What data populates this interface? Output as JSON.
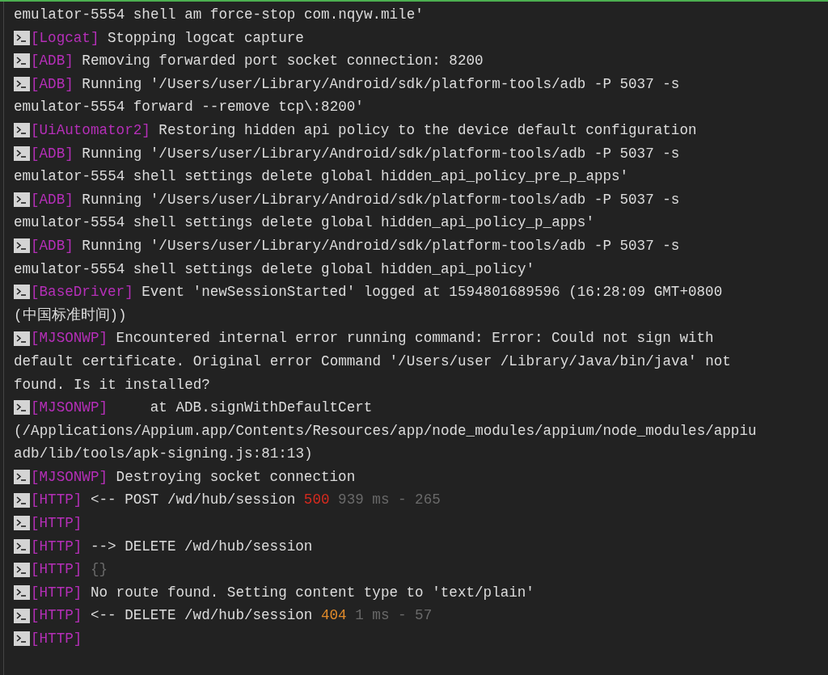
{
  "log": [
    {
      "kind": "wrap",
      "text": "emulator-5554 shell am force-stop com.nqyw.mile'"
    },
    {
      "kind": "entry",
      "tag": "[Logcat]",
      "segments": [
        {
          "kind": "text",
          "text": "Stopping logcat capture"
        }
      ]
    },
    {
      "kind": "entry",
      "tag": "[ADB]",
      "segments": [
        {
          "kind": "text",
          "text": "Removing forwarded port socket connection: 8200"
        }
      ]
    },
    {
      "kind": "entry",
      "tag": "[ADB]",
      "segments": [
        {
          "kind": "text",
          "text": "Running '/Users/user/Library/Android/sdk/platform-tools/adb -P 5037 -s"
        }
      ]
    },
    {
      "kind": "wrap",
      "text": "emulator-5554 forward --remove tcp\\:8200'"
    },
    {
      "kind": "entry",
      "tag": "[UiAutomator2]",
      "segments": [
        {
          "kind": "text",
          "text": "Restoring hidden api policy to the device default configuration"
        }
      ]
    },
    {
      "kind": "entry",
      "tag": "[ADB]",
      "segments": [
        {
          "kind": "text",
          "text": "Running '/Users/user/Library/Android/sdk/platform-tools/adb -P 5037 -s"
        }
      ]
    },
    {
      "kind": "wrap",
      "text": "emulator-5554 shell settings delete global hidden_api_policy_pre_p_apps'"
    },
    {
      "kind": "entry",
      "tag": "[ADB]",
      "segments": [
        {
          "kind": "text",
          "text": "Running '/Users/user/Library/Android/sdk/platform-tools/adb -P 5037 -s"
        }
      ]
    },
    {
      "kind": "wrap",
      "text": "emulator-5554 shell settings delete global hidden_api_policy_p_apps'"
    },
    {
      "kind": "entry",
      "tag": "[ADB]",
      "segments": [
        {
          "kind": "text",
          "text": "Running '/Users/user/Library/Android/sdk/platform-tools/adb -P 5037 -s"
        }
      ]
    },
    {
      "kind": "wrap",
      "text": "emulator-5554 shell settings delete global hidden_api_policy'"
    },
    {
      "kind": "entry",
      "tag": "[BaseDriver]",
      "segments": [
        {
          "kind": "text",
          "text": "Event 'newSessionStarted' logged at 1594801689596 (16:28:09 GMT+0800"
        }
      ]
    },
    {
      "kind": "wrap",
      "text": "(中国标准时间))"
    },
    {
      "kind": "entry",
      "tag": "[MJSONWP]",
      "segments": [
        {
          "kind": "text",
          "text": "Encountered internal error running command: Error: Could not sign with"
        }
      ]
    },
    {
      "kind": "wrap",
      "text": "default certificate. Original error Command '/Users/user /Library/Java/bin/java' not"
    },
    {
      "kind": "wrap",
      "text": "found. Is it installed?"
    },
    {
      "kind": "entry",
      "tag": "[MJSONWP]",
      "segments": [
        {
          "kind": "text",
          "text": "    at ADB.signWithDefaultCert"
        }
      ]
    },
    {
      "kind": "wrap",
      "text": "(/Applications/Appium.app/Contents/Resources/app/node_modules/appium/node_modules/appiu"
    },
    {
      "kind": "wrap",
      "text": "adb/lib/tools/apk-signing.js:81:13)"
    },
    {
      "kind": "entry",
      "tag": "[MJSONWP]",
      "segments": [
        {
          "kind": "text",
          "text": "Destroying socket connection"
        }
      ]
    },
    {
      "kind": "entry",
      "tag": "[HTTP]",
      "segments": [
        {
          "kind": "text",
          "text": "<-- POST /wd/hub/session"
        },
        {
          "kind": "error",
          "text": "500"
        },
        {
          "kind": "dim",
          "text": "939 ms - 265"
        }
      ]
    },
    {
      "kind": "entry",
      "tag": "[HTTP]"
    },
    {
      "kind": "entry",
      "tag": "[HTTP]",
      "segments": [
        {
          "kind": "text",
          "text": "--> DELETE /wd/hub/session"
        }
      ]
    },
    {
      "kind": "entry",
      "tag": "[HTTP]",
      "segments": [
        {
          "kind": "dim",
          "text": "{}"
        }
      ]
    },
    {
      "kind": "entry",
      "tag": "[HTTP]",
      "segments": [
        {
          "kind": "text",
          "text": "No route found. Setting content type to 'text/plain'"
        }
      ]
    },
    {
      "kind": "entry",
      "tag": "[HTTP]",
      "segments": [
        {
          "kind": "text",
          "text": "<-- DELETE /wd/hub/session"
        },
        {
          "kind": "warn",
          "text": "404"
        },
        {
          "kind": "dim",
          "text": "1 ms - 57"
        }
      ]
    },
    {
      "kind": "entry",
      "tag": "[HTTP]"
    }
  ]
}
